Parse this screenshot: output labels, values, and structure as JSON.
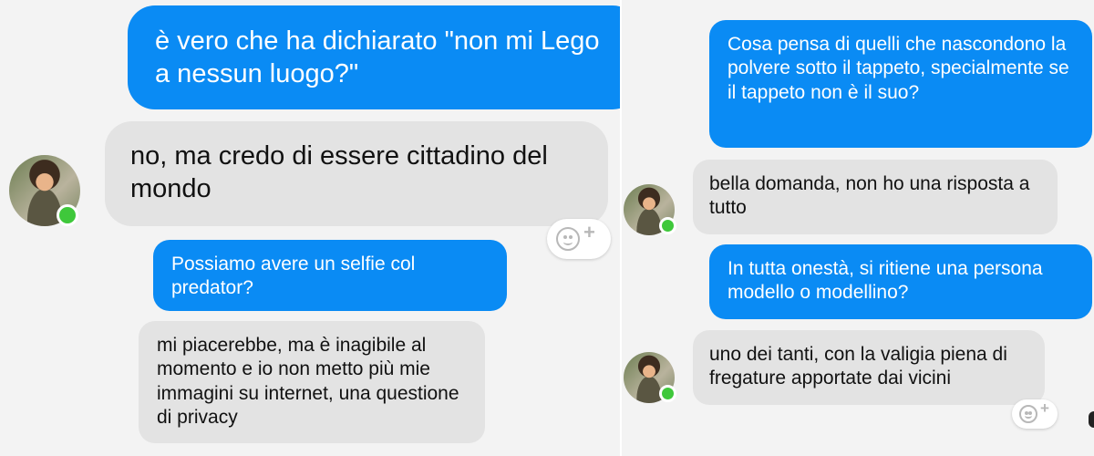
{
  "left_chat": {
    "messages": [
      {
        "type": "outgoing",
        "text": "è vero che ha dichiarato \"non mi Lego a nessun luogo?\""
      },
      {
        "type": "incoming",
        "text": "no, ma credo di essere cittadino del mondo"
      },
      {
        "type": "outgoing",
        "text": "Possiamo avere un selfie col predator?"
      },
      {
        "type": "incoming",
        "text": "mi piacerebbe, ma è inagibile al momento e io non metto più mie immagini su internet, una questione di privacy"
      }
    ],
    "reaction_plus": "+"
  },
  "right_chat": {
    "messages": [
      {
        "type": "outgoing",
        "text": "Cosa pensa di quelli che nascondono la polvere sotto il tappeto, specialmente se il tappeto non è il suo?"
      },
      {
        "type": "incoming",
        "text": "bella domanda, non ho una risposta a tutto"
      },
      {
        "type": "outgoing",
        "text": "In tutta onestà, si ritiene una persona modello o modellino?"
      },
      {
        "type": "incoming",
        "text": "uno dei tanti, con la valigia piena di fregature apportate dai vicini"
      }
    ],
    "reaction_plus": "+"
  },
  "colors": {
    "outgoing_bubble": "#0a8bf4",
    "incoming_bubble": "#e3e3e3",
    "online_indicator": "#3fc83b"
  },
  "icons": {
    "avatar": "contact-avatar",
    "presence": "online-status-dot",
    "reaction": "add-reaction-icon"
  }
}
